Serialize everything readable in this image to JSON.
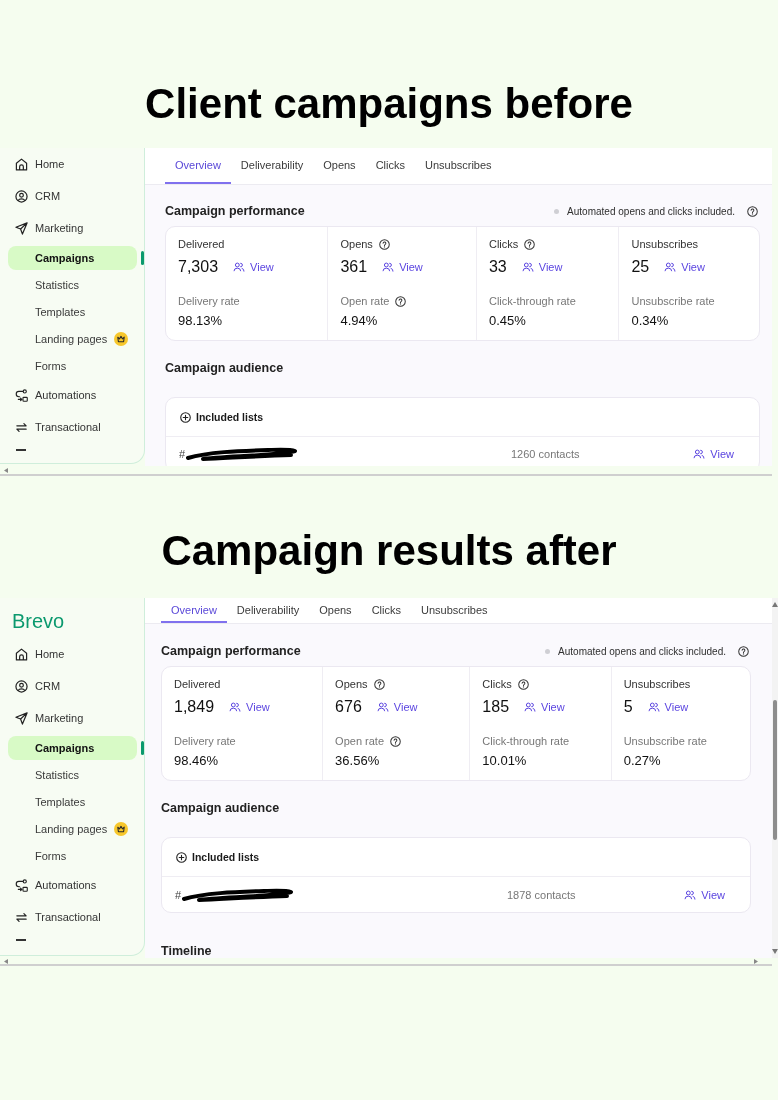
{
  "sections": [
    {
      "heading": "Client campaigns before",
      "screenshot": {
        "sidebar": {
          "items": [
            {
              "label": "Home",
              "selected": false
            },
            {
              "label": "CRM",
              "selected": false
            },
            {
              "label": "Marketing",
              "selected": false,
              "children": [
                {
                  "label": "Campaigns",
                  "selected": true,
                  "badge": false
                },
                {
                  "label": "Statistics",
                  "selected": false,
                  "badge": false
                },
                {
                  "label": "Templates",
                  "selected": false,
                  "badge": false
                },
                {
                  "label": "Landing pages",
                  "selected": false,
                  "badge": true
                },
                {
                  "label": "Forms",
                  "selected": false,
                  "badge": false
                }
              ]
            },
            {
              "label": "Automations",
              "selected": false
            },
            {
              "label": "Transactional",
              "selected": false
            }
          ]
        },
        "tabs": [
          {
            "label": "Overview",
            "selected": true
          },
          {
            "label": "Deliverability",
            "selected": false
          },
          {
            "label": "Opens",
            "selected": false
          },
          {
            "label": "Clicks",
            "selected": false
          },
          {
            "label": "Unsubscribes",
            "selected": false
          }
        ],
        "performance": {
          "title": "Campaign performance",
          "note": "Automated opens and clicks included.",
          "metrics": [
            {
              "label": "Delivered",
              "help": false,
              "value": "7,303",
              "link": "View",
              "rate_label": "Delivery rate",
              "rate_help": false,
              "rate": "98.13%"
            },
            {
              "label": "Opens",
              "help": true,
              "value": "361",
              "link": "View",
              "rate_label": "Open rate",
              "rate_help": true,
              "rate": "4.94%"
            },
            {
              "label": "Clicks",
              "help": true,
              "value": "33",
              "link": "View",
              "rate_label": "Click-through rate",
              "rate_help": false,
              "rate": "0.45%"
            },
            {
              "label": "Unsubscribes",
              "help": false,
              "value": "25",
              "link": "View",
              "rate_label": "Unsubscribe rate",
              "rate_help": false,
              "rate": "0.34%"
            }
          ]
        },
        "audience": {
          "title": "Campaign audience",
          "lists_title": "Included lists",
          "rows": [
            {
              "name": "#",
              "redacted": true,
              "contacts": "1260 contacts",
              "link": "View"
            }
          ]
        },
        "vertical_scrollbar": false
      }
    },
    {
      "heading": "Campaign results after",
      "screenshot": {
        "logo": "Brevo",
        "sidebar": {
          "items": [
            {
              "label": "Home",
              "selected": false
            },
            {
              "label": "CRM",
              "selected": false
            },
            {
              "label": "Marketing",
              "selected": false,
              "children": [
                {
                  "label": "Campaigns",
                  "selected": true,
                  "badge": false
                },
                {
                  "label": "Statistics",
                  "selected": false,
                  "badge": false
                },
                {
                  "label": "Templates",
                  "selected": false,
                  "badge": false
                },
                {
                  "label": "Landing pages",
                  "selected": false,
                  "badge": true
                },
                {
                  "label": "Forms",
                  "selected": false,
                  "badge": false
                }
              ]
            },
            {
              "label": "Automations",
              "selected": false
            },
            {
              "label": "Transactional",
              "selected": false
            }
          ]
        },
        "tabs": [
          {
            "label": "Overview",
            "selected": true
          },
          {
            "label": "Deliverability",
            "selected": false
          },
          {
            "label": "Opens",
            "selected": false
          },
          {
            "label": "Clicks",
            "selected": false
          },
          {
            "label": "Unsubscribes",
            "selected": false
          }
        ],
        "performance": {
          "title": "Campaign performance",
          "note": "Automated opens and clicks included.",
          "metrics": [
            {
              "label": "Delivered",
              "help": false,
              "value": "1,849",
              "link": "View",
              "rate_label": "Delivery rate",
              "rate_help": false,
              "rate": "98.46%"
            },
            {
              "label": "Opens",
              "help": true,
              "value": "676",
              "link": "View",
              "rate_label": "Open rate",
              "rate_help": true,
              "rate": "36.56%"
            },
            {
              "label": "Clicks",
              "help": true,
              "value": "185",
              "link": "View",
              "rate_label": "Click-through rate",
              "rate_help": false,
              "rate": "10.01%"
            },
            {
              "label": "Unsubscribes",
              "help": false,
              "value": "5",
              "link": "View",
              "rate_label": "Unsubscribe rate",
              "rate_help": false,
              "rate": "0.27%"
            }
          ]
        },
        "audience": {
          "title": "Campaign audience",
          "lists_title": "Included lists",
          "rows": [
            {
              "name": "#",
              "redacted": true,
              "contacts": "1878 contacts",
              "link": "View"
            }
          ]
        },
        "timeline_title": "Timeline",
        "vertical_scrollbar": true
      }
    }
  ]
}
